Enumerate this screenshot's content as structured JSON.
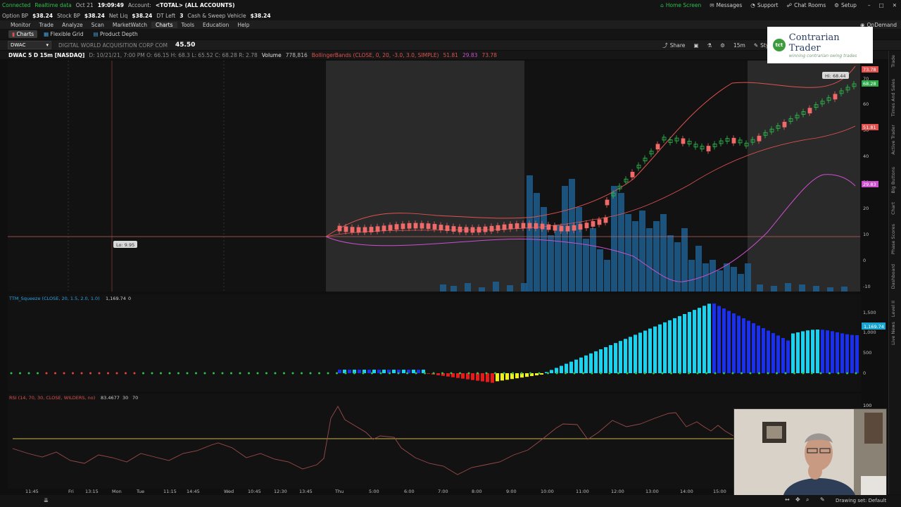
{
  "status_bar": {
    "connected": "Connected",
    "realtime": "Realtime data",
    "date": "Oct 21",
    "time": "19:09:49",
    "account_label": "Account:",
    "account_value": "<TOTAL> (ALL ACCOUNTS)",
    "home_screen": "Home Screen",
    "messages": "Messages",
    "support": "Support",
    "chat_rooms": "Chat Rooms",
    "setup": "Setup"
  },
  "balances": [
    {
      "label": "Option BP",
      "value": "$38.24"
    },
    {
      "label": "Stock BP",
      "value": "$38.24"
    },
    {
      "label": "Net Liq",
      "value": "$38.24"
    },
    {
      "label": "DT Left",
      "value": "3"
    },
    {
      "label": "Cash & Sweep Vehicle",
      "value": "$38.24"
    }
  ],
  "menu": [
    "Monitor",
    "Trade",
    "Analyze",
    "Scan",
    "MarketWatch",
    "Charts",
    "Tools",
    "Education",
    "Help"
  ],
  "menu_selected": "Charts",
  "ondemand": "OnDemand",
  "chart_tabs": [
    "Charts",
    "Flexible Grid",
    "Product Depth"
  ],
  "symbol_bar": {
    "symbol": "DWAC",
    "company": "DIGITAL WORLD ACQUISITION CORP COM",
    "price": "45.50",
    "share": "Share",
    "interval": "15m",
    "style": "Style"
  },
  "info_line": {
    "title": "DWAC 5 D 15m [NASDAQ]",
    "ohlc": "D: 10/21/21, 7:00 PM  O: 66.15  H: 68.3  L: 65.52  C: 68.28  R: 2.78",
    "volume_label": "Volume",
    "volume_value": "778,816",
    "bb": "BollingerBands (CLOSE, 0, 20, -3.0, 3.0, SIMPLE)",
    "bb_values": [
      "51.81",
      "29.83",
      "73.78"
    ]
  },
  "logo": {
    "mark": "tct",
    "main": "Contrarian Trader",
    "sub": "winning contrarian swing trades"
  },
  "hi_label": "Hi: 68.44",
  "lo_label": "Lo: 9.95",
  "price_axis": [
    "70",
    "60",
    "50",
    "40",
    "30",
    "20",
    "10",
    "0",
    "-10"
  ],
  "price_badges": [
    {
      "text": "73.78",
      "color": "#e0524f"
    },
    {
      "text": "68.28",
      "color": "#2fa84a"
    },
    {
      "text": "51.81",
      "color": "#e0524f"
    },
    {
      "text": "29.83",
      "color": "#cc4fcf"
    }
  ],
  "squeeze": {
    "label": "TTM_Squeeze (CLOSE, 20, 1.5, 2.0, 1.0)",
    "value": "1,169.74",
    "extra": "0",
    "axis": [
      "1,500",
      "1,000",
      "500",
      "0"
    ],
    "badge": "1,169.74"
  },
  "rsi": {
    "label": "RSI (14, 70, 30, CLOSE, WILDERS, no)",
    "value": "83.4677",
    "levels": [
      "30",
      "70"
    ],
    "axis": [
      "100"
    ]
  },
  "time_axis": [
    "11:45",
    "Fri",
    "13:15",
    "Mon",
    "Tue",
    "11:15",
    "14:45",
    "Wed",
    "10:45",
    "12:30",
    "13:45",
    "Thu",
    "5:00",
    "6:00",
    "7:00",
    "8:00",
    "9:00",
    "10:00",
    "11:00",
    "12:00",
    "13:00",
    "14:00",
    "15:00"
  ],
  "drawing_set": "Drawing set: Default",
  "right_rail": [
    "Trade",
    "Times And Sales",
    "Active Trader",
    "Big Buttons",
    "Chart",
    "Phase Scores",
    "Dashboard",
    "Level II",
    "Live News"
  ],
  "colors": {
    "up_candle": "#2fbf4f",
    "down_candle": "#f06a6a",
    "volume": "#1f5f8f",
    "bb_upper": "#e0524f",
    "bb_lower": "#cc4fcf",
    "squeeze_cyan": "#19d3f0",
    "squeeze_blue": "#1a2ff0",
    "squeeze_red": "#e81a1a",
    "squeeze_yellow": "#f0f01a"
  }
}
